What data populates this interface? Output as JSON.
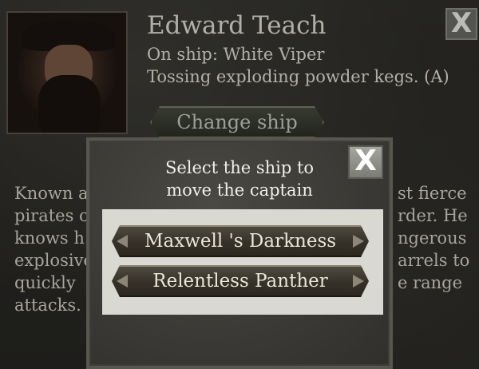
{
  "captain": {
    "name": "Edward Teach",
    "ship_line": "On ship: White Viper",
    "ability_line": "Tossing exploding powder kegs. (A)",
    "change_ship_label": "Change ship",
    "close_label": "X",
    "description_fragments": {
      "l1a": "Known a",
      "l1b": "st fierce",
      "l2a": "pirates o",
      "l2b": "rder. He",
      "l3a": "knows h",
      "l3b": "ngerous",
      "l4a": "explosive",
      "l4b": "arrels to",
      "l5a": "quickly",
      "l5b": "e range",
      "l6a": "attacks."
    }
  },
  "modal": {
    "title_line1": "Select the ship to",
    "title_line2": "move the captain",
    "close_label": "X",
    "ships": [
      {
        "label": "Maxwell 's Darkness"
      },
      {
        "label": "Relentless Panther"
      }
    ]
  }
}
